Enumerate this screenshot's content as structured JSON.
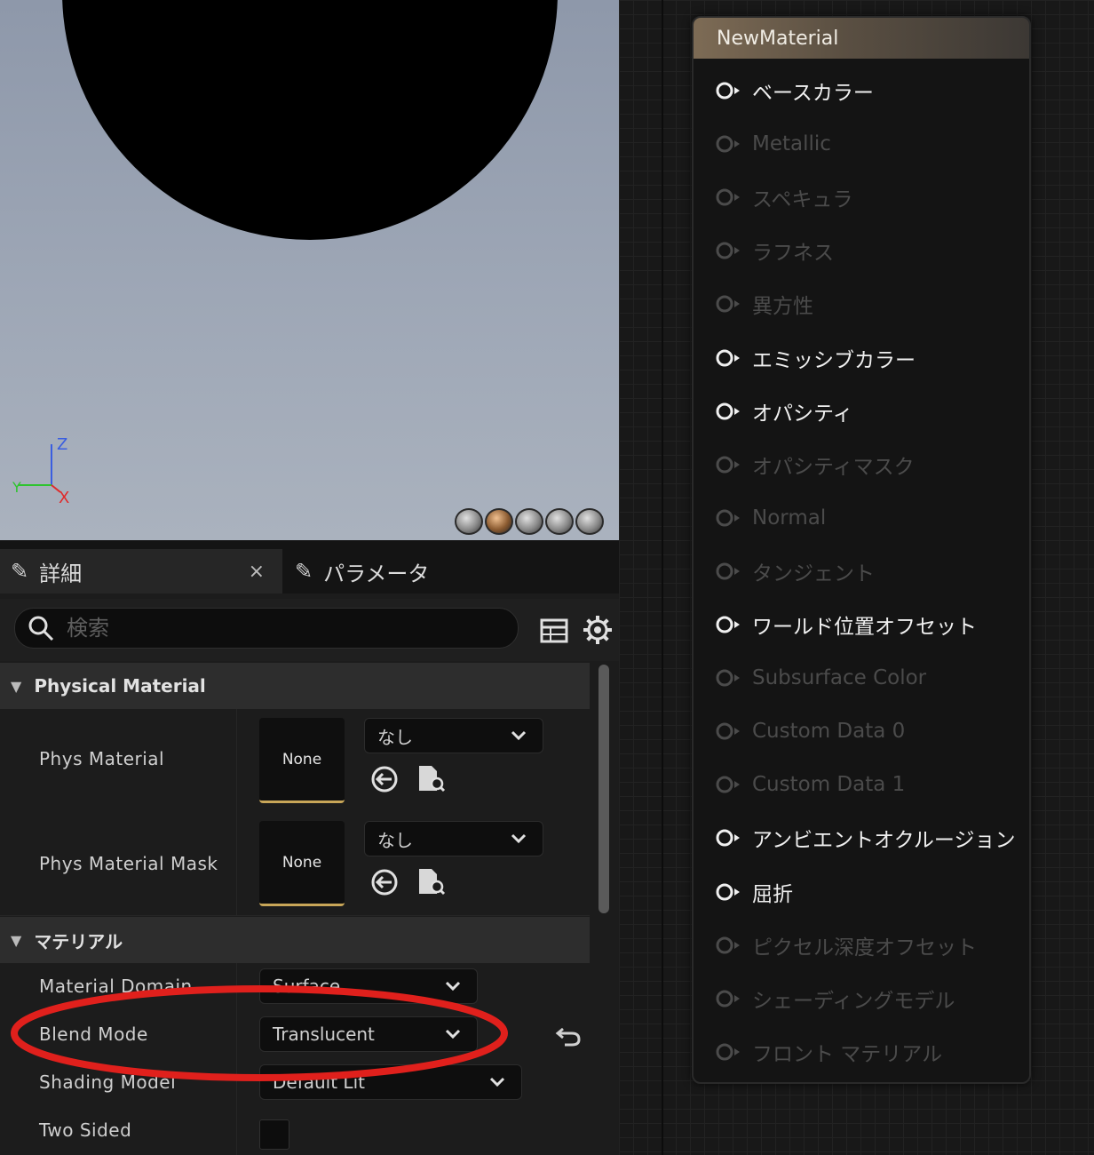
{
  "viewport": {
    "axis": {
      "z": "Z",
      "y": "Y",
      "x": "X"
    },
    "preview_buttons": [
      "cylinder-preview",
      "sphere-preview",
      "plane-preview",
      "cube-preview",
      "custom-mesh-preview"
    ]
  },
  "tabs": [
    {
      "label": "詳細",
      "icon": "pencil-details-icon",
      "closable": true
    },
    {
      "label": "パラメータ",
      "icon": "pencil-params-icon"
    }
  ],
  "tab_close": "×",
  "search": {
    "placeholder": "検索",
    "value": ""
  },
  "sections": {
    "physical": "Physical Material",
    "material": "マテリアル"
  },
  "properties": {
    "phys_material": {
      "label": "Phys Material",
      "thumb": "None",
      "value": "なし"
    },
    "phys_material_mask": {
      "label": "Phys Material Mask",
      "thumb": "None",
      "value": "なし"
    },
    "material_domain": {
      "label": "Material Domain",
      "value": "Surface"
    },
    "blend_mode": {
      "label": "Blend Mode",
      "value": "Translucent"
    },
    "shading_model": {
      "label": "Shading Model",
      "value": "Default Lit"
    },
    "two_sided": {
      "label": "Two Sided",
      "checked": false
    }
  },
  "node": {
    "title": "NewMaterial",
    "pins": [
      {
        "label": "ベースカラー",
        "active": true
      },
      {
        "label": "Metallic",
        "active": false
      },
      {
        "label": "スペキュラ",
        "active": false
      },
      {
        "label": "ラフネス",
        "active": false
      },
      {
        "label": "異方性",
        "active": false
      },
      {
        "label": "エミッシブカラー",
        "active": true
      },
      {
        "label": "オパシティ",
        "active": true
      },
      {
        "label": "オパシティマスク",
        "active": false
      },
      {
        "label": "Normal",
        "active": false
      },
      {
        "label": "タンジェント",
        "active": false
      },
      {
        "label": "ワールド位置オフセット",
        "active": true
      },
      {
        "label": "Subsurface Color",
        "active": false
      },
      {
        "label": "Custom Data 0",
        "active": false
      },
      {
        "label": "Custom Data 1",
        "active": false
      },
      {
        "label": "アンビエントオクルージョン",
        "active": true
      },
      {
        "label": "屈折",
        "active": true
      },
      {
        "label": "ピクセル深度オフセット",
        "active": false
      },
      {
        "label": "シェーディングモデル",
        "active": false
      },
      {
        "label": "フロント マテリアル",
        "active": false
      }
    ]
  },
  "colors": {
    "annotation": "#e0201c",
    "accent_gold": "#c8a658",
    "pin_active": "#f0f0f0",
    "pin_inactive": "#4b4b4b"
  }
}
